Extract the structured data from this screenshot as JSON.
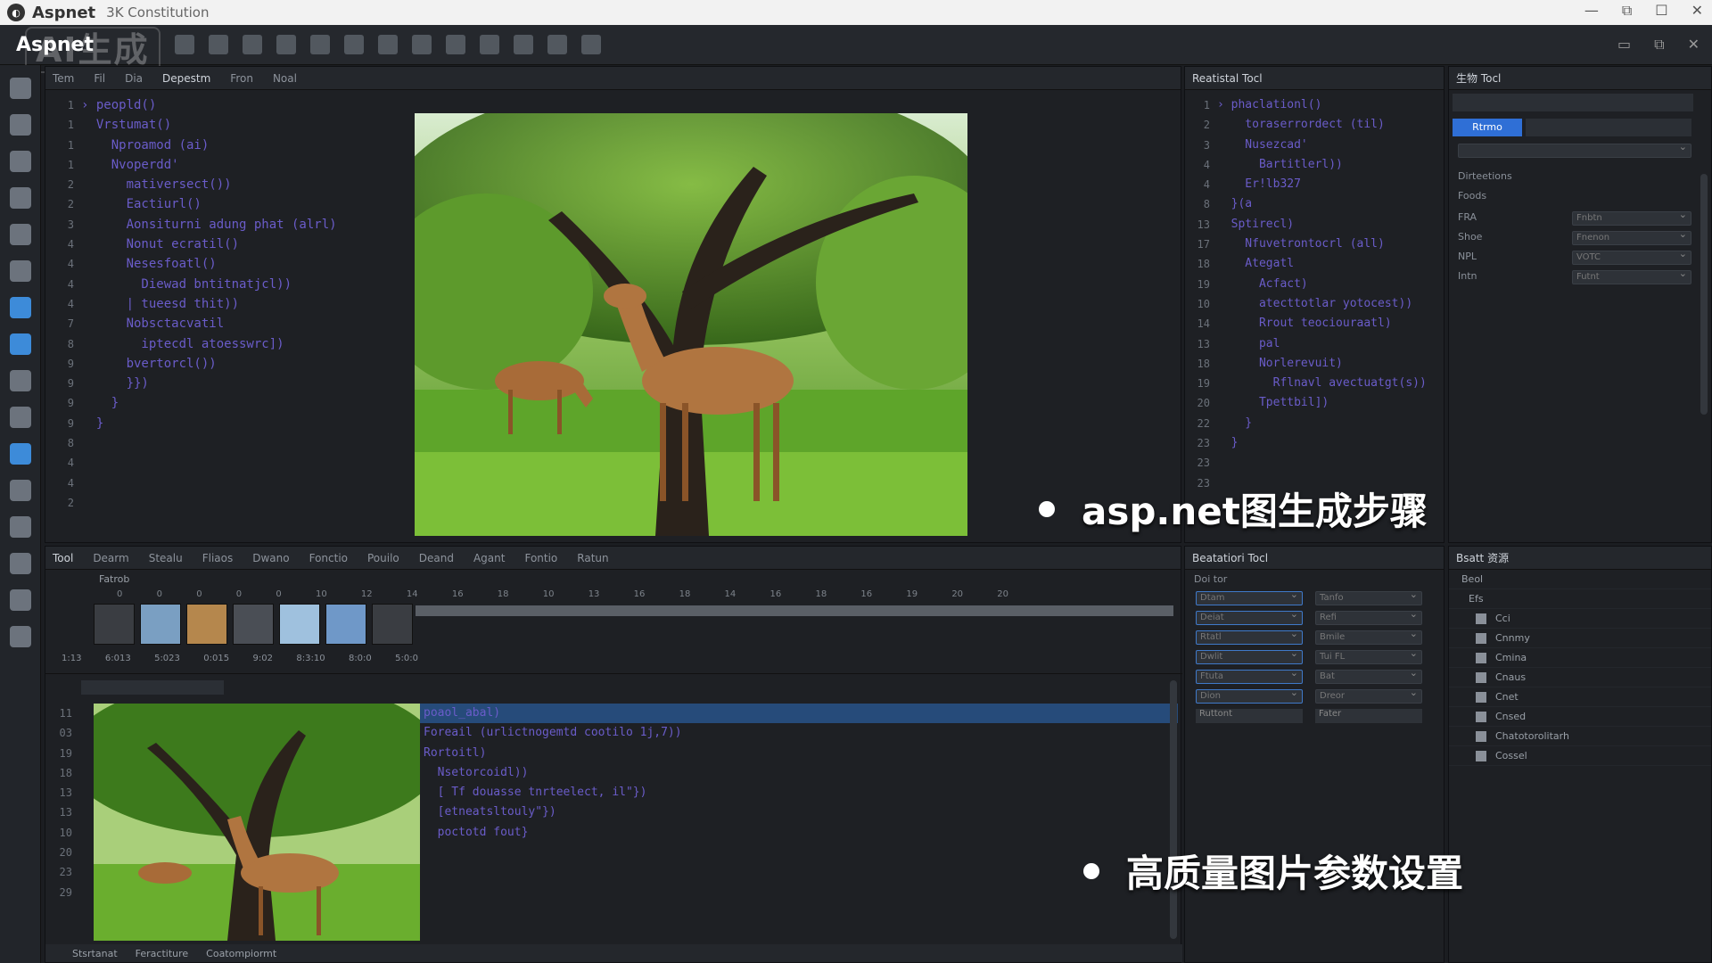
{
  "titlebar": {
    "app": "Aspnet",
    "subtitle": "3K Constitution"
  },
  "toolbar": {
    "brand": "Aspnet",
    "watermark": "AI生成"
  },
  "editor_tabs": [
    "Tem",
    "Fil",
    "Dia",
    "Depestm",
    "Fron",
    "Noal"
  ],
  "main_code": {
    "gutter": [
      "1",
      "1",
      "1",
      "1",
      "2",
      "2",
      "3",
      "4",
      "4",
      "4",
      "4",
      "7",
      "8",
      "9",
      "9",
      "9",
      "9",
      "8",
      "4",
      "4",
      "2"
    ],
    "lines": [
      "› peopld()",
      "  Vrstumat()",
      "    Nproamod (ai)",
      "    Nvoperdd'",
      "      mativersect())",
      "      Eactiurl()",
      "      Aonsiturni adung phat (alrl)",
      "      Nonut ecratil()",
      "      Nesesfoatl()",
      "        Diewad bntitnatjcl))",
      "      | tueesd thit))",
      "      Nobsctacvatil",
      "        iptecdl atoesswrc])",
      "      bvertorcl())",
      "      }})",
      "    }",
      "  }"
    ]
  },
  "right_code": {
    "title": "Reatistal Tocl",
    "gutter": [
      "1",
      "2",
      "3",
      "4",
      "4",
      "8",
      "13",
      "17",
      "18",
      "19",
      "10",
      "14",
      "13",
      "18",
      "19",
      "20",
      "22",
      "23",
      "23",
      "23"
    ],
    "lines": [
      "› phaclationl()",
      "    toraserrordect (til)",
      "    Nusezcad'",
      "      Bartitlerl))",
      "    Er!lb327",
      "  }(a",
      "  Sptirecl)",
      "    Nfuvetrontocrl (all)",
      "    Ategatl",
      "      Acfact)",
      "      atecttotlar yotocest))",
      "      Rrout teociouraatl)",
      "      pal",
      "      Norlerevuit)",
      "        Rflnavl avectuatgt(s))",
      "      Tpettbil])",
      "    }",
      "  }"
    ]
  },
  "props": {
    "title": "生物 Tocl",
    "run_btn": "Rtrmo",
    "row_labels": [
      "Dirteetions",
      "Foods",
      "FRA",
      "Shoe",
      "NPL",
      "Intn"
    ],
    "row_values": [
      "Fnbtn",
      "Fnenon",
      "VOTC",
      "Futnt"
    ]
  },
  "bottom_tabs": [
    "Tool",
    "Dearm",
    "Stealu",
    "Fliaos",
    "Dwano",
    "Fonctio",
    "Pouilo",
    "Deand",
    "Agant",
    "Fontio",
    "Ratun"
  ],
  "timeline": {
    "track": "Fatrob",
    "ruler": [
      "0",
      "0",
      "0",
      "0",
      "0",
      "10",
      "12",
      "14",
      "16",
      "18",
      "10",
      "13",
      "16",
      "18",
      "14",
      "16",
      "18",
      "16",
      "19",
      "20",
      "20"
    ],
    "times": [
      "1:13",
      "6:013",
      "5:023",
      "0:015",
      "9:02",
      "8:3:10",
      "8:0:0",
      "5:0:0"
    ]
  },
  "bottom_code": {
    "gutter": [
      "11",
      "03",
      "19",
      "18",
      "13",
      "13",
      "10",
      "20",
      "23",
      "29"
    ],
    "lines": [
      "poaol_abal)",
      "Foreail (urlictnogemtd cootilo 1j,7))",
      "Rortoitl)",
      "  Nsetorcoidl))",
      "  [ Tf douasse tnrteelect, il\"})",
      "  [etneatsltouly\"})",
      "  poctotd fout}"
    ]
  },
  "inspector": {
    "title": "Beatatiori Tocl",
    "header": "Doi tor",
    "left_fields": [
      "Dtam",
      "Deiat",
      "Rtatl",
      "Dwlit",
      "Ftuta",
      "Dion"
    ],
    "right_fields": [
      "Tanfo",
      "Refi",
      "Bmile",
      "Tui FL",
      "Bat",
      "Dreor"
    ],
    "footer_left": "Ruttont",
    "footer_right": "Fater"
  },
  "tree": {
    "title": "Bsatt 资源",
    "root": "Beol",
    "folder": "Efs",
    "items": [
      "Cci",
      "Cnnmy",
      "Cmina",
      "Cnaus",
      "Cnet",
      "Cnsed",
      "Chatotorolitarh",
      "Cossel"
    ]
  },
  "status_tabs": [
    "Stsrtanat",
    "Feractiture",
    "Coatompiormt"
  ],
  "bullets": [
    "asp.net图生成步骤",
    "高质量图片参数设置"
  ]
}
